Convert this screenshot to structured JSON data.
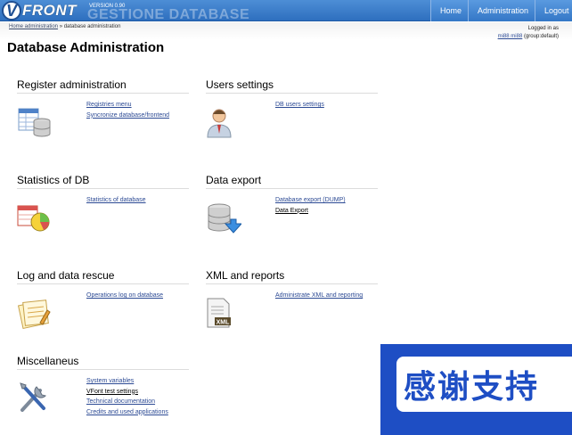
{
  "header": {
    "logo_letter": "V",
    "logo_text": "FRONT",
    "version": "VERSION 0.90",
    "ghost_title": "GESTIONE DATABASE",
    "nav": [
      {
        "label": "Home"
      },
      {
        "label": "Administration"
      },
      {
        "label": "Logout"
      }
    ]
  },
  "breadcrumb": {
    "home": "Home administration",
    "separator": "»",
    "current": "database administration"
  },
  "login": {
    "line1": "Logged in as",
    "user": "mi88 mi88",
    "group": "(group:default)"
  },
  "page_title": "Database Administration",
  "sections": [
    {
      "title": "Register administration",
      "icon": "registry-db-icon",
      "links": [
        "Registries menu",
        "Syncronize database/frontend"
      ]
    },
    {
      "title": "Users settings",
      "icon": "user-icon",
      "links": [
        "DB users settings"
      ]
    },
    {
      "title": "Statistics of DB",
      "icon": "statistics-pie-icon",
      "links": [
        "Statistics of database"
      ]
    },
    {
      "title": "Data export",
      "icon": "database-export-icon",
      "links": [
        "Database export (DUMP)",
        "Data Export"
      ]
    },
    {
      "title": "Log and data rescue",
      "icon": "log-notes-icon",
      "links": [
        "Operations log on database"
      ]
    },
    {
      "title": "XML and reports",
      "icon": "xml-file-icon",
      "links": [
        "Administrate XML and reporting"
      ]
    },
    {
      "title": "Miscellaneus",
      "icon": "tools-icon",
      "links": [
        "System variables",
        "VFont test settings",
        "Technical documentation",
        "Credits and used applications"
      ]
    }
  ],
  "overlay": {
    "text": "感谢支持"
  },
  "colors": {
    "header": "#3477c6",
    "link": "#2c4a94",
    "overlay": "#1e4ec4"
  }
}
